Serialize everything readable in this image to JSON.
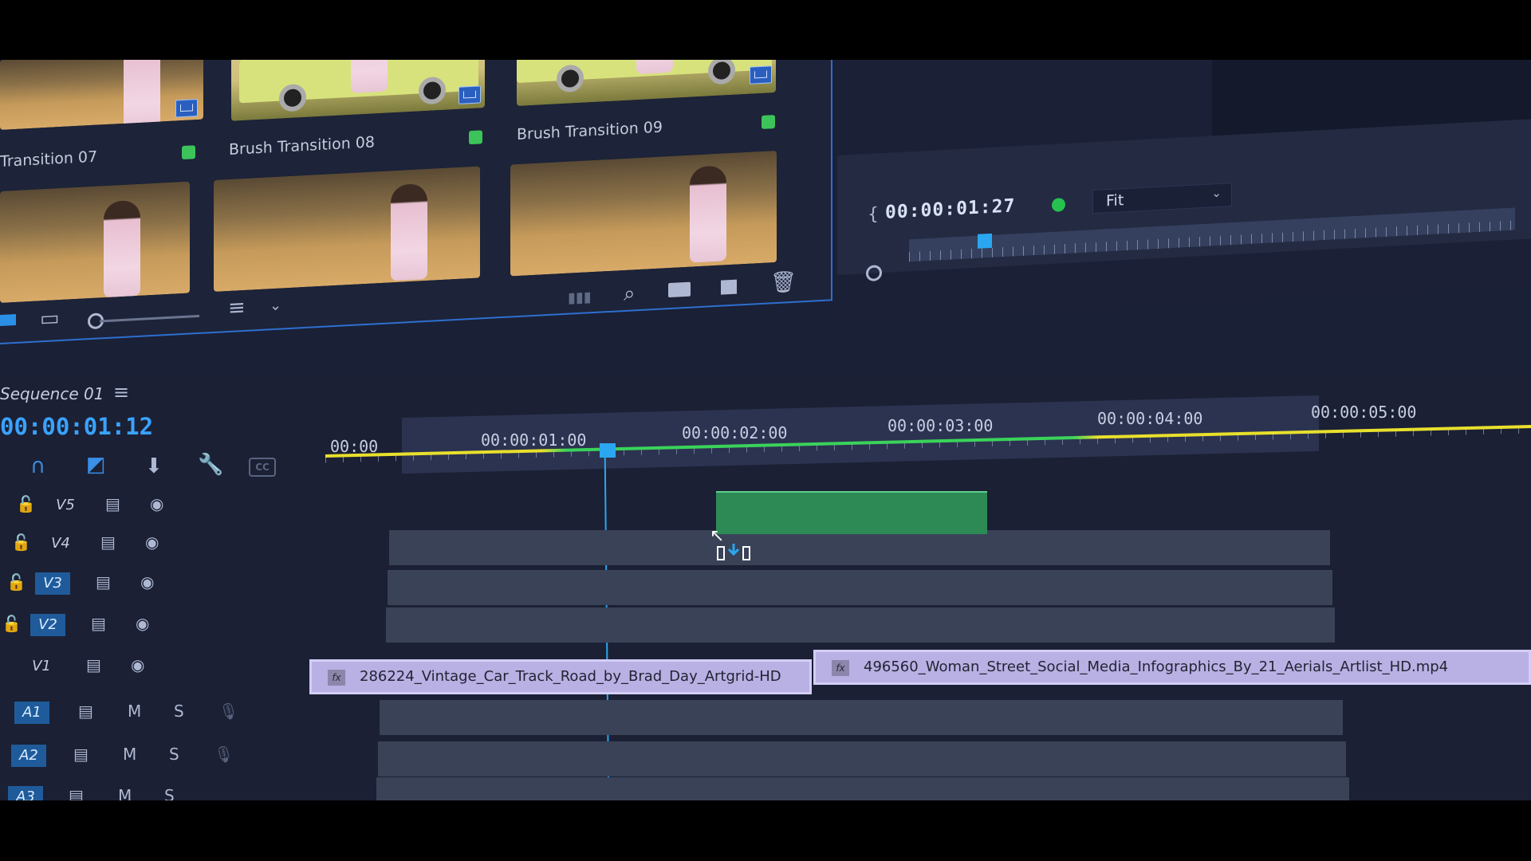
{
  "project_panel": {
    "items": [
      {
        "label": "Transition 07"
      },
      {
        "label": "Brush Transition 08"
      },
      {
        "label": "Brush Transition 09"
      }
    ],
    "toolbar_icons": [
      "list-view-icon",
      "freeform-view-icon",
      "zoom-slider",
      "sort-icon",
      "automate-icon",
      "find-icon",
      "new-bin-icon",
      "new-item-icon",
      "delete-icon"
    ]
  },
  "program_monitor": {
    "timecode": "00:00:01:27",
    "fit_value": "Fit",
    "status_color": "#26c24e"
  },
  "timeline": {
    "sequence_title": "Sequence 01",
    "timecode": "00:00:01:12",
    "ruler": [
      "00:00",
      "00:00:01:00",
      "00:00:02:00",
      "00:00:03:00",
      "00:00:04:00",
      "00:00:05:00"
    ],
    "tracks": {
      "video": [
        "V5",
        "V4",
        "V3",
        "V2",
        "V1"
      ],
      "audio": [
        "A1",
        "A2",
        "A3"
      ],
      "mute_label": "M",
      "solo_label": "S"
    },
    "clips": {
      "v1_a": "286224_Vintage_Car_Track_Road_by_Brad_Day_Artgrid-HD",
      "v1_b": "496560_Woman_Street_Social_Media_Infographics_By_21_Aerials_Artlist_HD.mp4",
      "fx_label": "fx"
    },
    "tools": {
      "cc_label": "CC"
    },
    "colors": {
      "accent": "#2aa7f0",
      "clip_green": "#2d8a55",
      "clip_purple": "#b9b0e4"
    }
  }
}
